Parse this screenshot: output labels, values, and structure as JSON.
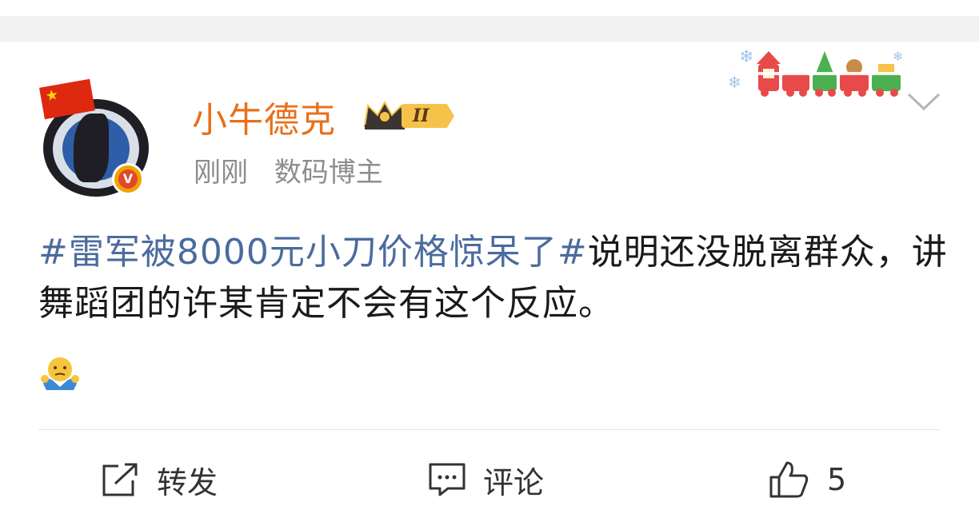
{
  "post": {
    "username": "小牛德克",
    "vip_level": "II",
    "time": "刚刚",
    "identity": "数码博主",
    "hashtag": "#雷军被8000元小刀价格惊呆了#",
    "body": "说明还没脱离群众，讲舞蹈团的许某肯定不会有这个反应。",
    "emoji_icon": "shrug-emoji-icon"
  },
  "actions": {
    "repost_label": "转发",
    "comment_label": "评论",
    "like_count": "5"
  },
  "colors": {
    "username": "#e8701a",
    "hashtag": "#4b6b9e",
    "meta": "#8d8d8d",
    "body": "#1a1a1a"
  }
}
